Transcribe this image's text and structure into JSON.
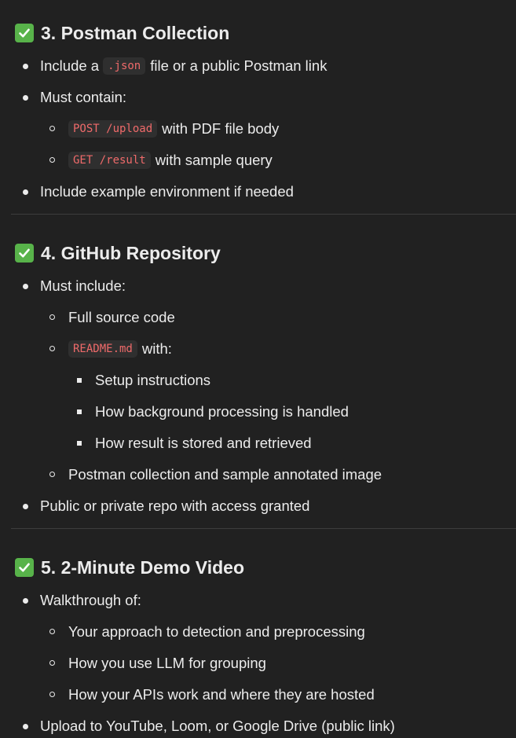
{
  "sections": [
    {
      "title": "3. Postman Collection",
      "items": {
        "i1_code": ".json",
        "i1_text": "file or a public Postman link",
        "i2_text": "Must contain:",
        "i2a_code": "POST /upload",
        "i2a_text": "with PDF file body",
        "i2b_code": "GET /result",
        "i2b_text": "with sample query",
        "i3_text": "Include example environment if needed",
        "i1_prefix": "Include a"
      }
    },
    {
      "title": "4. GitHub Repository",
      "items": {
        "i1_text": "Must include:",
        "i1a_text": "Full source code",
        "i1b_code": "README.md",
        "i1b_text": "with:",
        "i1b1_text": "Setup instructions",
        "i1b2_text": "How background processing is handled",
        "i1b3_text": "How result is stored and retrieved",
        "i1c_text": "Postman collection and sample annotated image",
        "i2_text": "Public or private repo with access granted"
      }
    },
    {
      "title": "5. 2-Minute Demo Video",
      "items": {
        "i1_text": "Walkthrough of:",
        "i1a_text": "Your approach to detection and preprocessing",
        "i1b_text": "How you use LLM for grouping",
        "i1c_text": "How your APIs work and where they are hosted",
        "i2_text": "Upload to YouTube, Loom, or Google Drive (public link)"
      }
    }
  ],
  "icons": {
    "check": "check-mark-button-icon",
    "check_color": "#58b34a",
    "code_color": "#ef6a6a"
  }
}
